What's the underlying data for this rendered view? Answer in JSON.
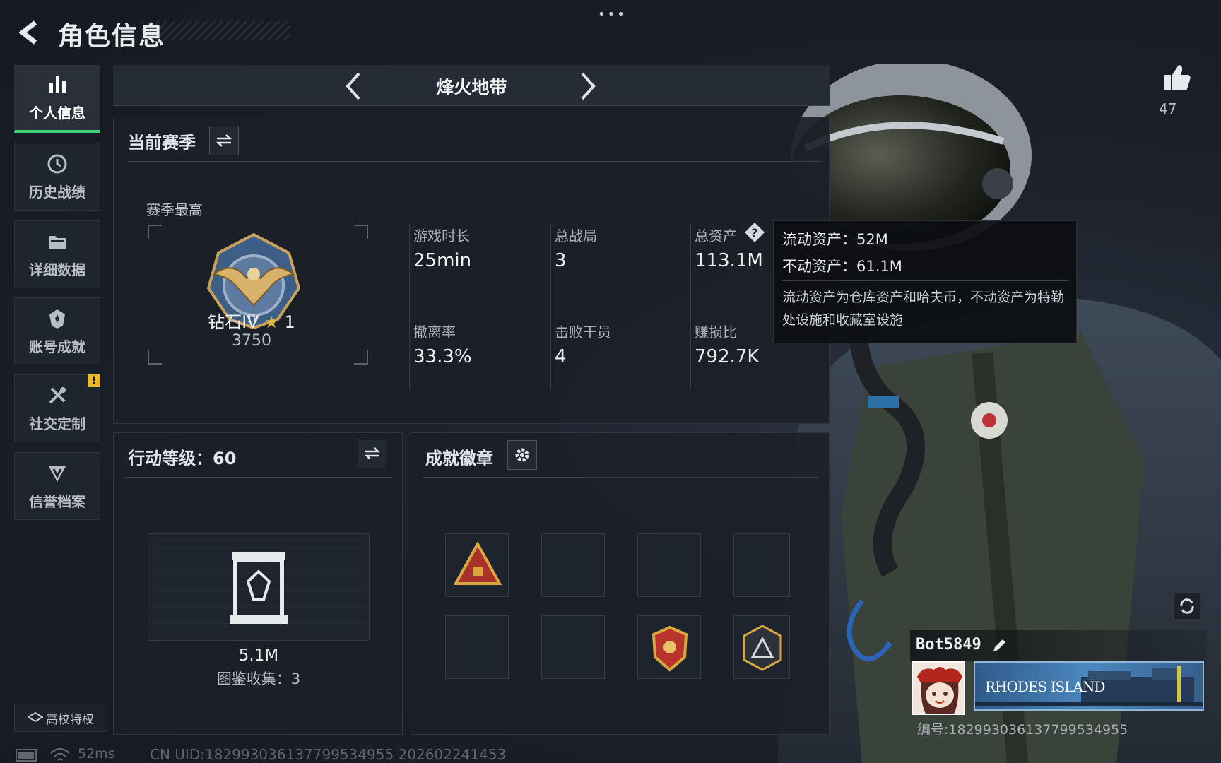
{
  "header": {
    "title": "角色信息",
    "more": "•••"
  },
  "sidebar": {
    "items": [
      {
        "label": "个人信息",
        "icon": "bar-chart-icon",
        "active": true
      },
      {
        "label": "历史战绩",
        "icon": "history-icon"
      },
      {
        "label": "详细数据",
        "icon": "folder-icon"
      },
      {
        "label": "账号成就",
        "icon": "achievement-icon"
      },
      {
        "label": "社交定制",
        "icon": "tools-icon",
        "alert": "!"
      },
      {
        "label": "信誉档案",
        "icon": "credit-icon"
      }
    ],
    "campus": "高校特权"
  },
  "mode": {
    "name": "烽火地带"
  },
  "season": {
    "title": "当前赛季",
    "best_label": "赛季最高",
    "rank": "钻石IV",
    "stars": "1",
    "rank_score": "3750",
    "stats": [
      {
        "label": "游戏时长",
        "value": "25min"
      },
      {
        "label": "总战局",
        "value": "3"
      },
      {
        "label": "总资产",
        "value": "113.1M"
      },
      {
        "label": "撤离率",
        "value": "33.3%"
      },
      {
        "label": "击败干员",
        "value": "4"
      },
      {
        "label": "赚损比",
        "value": "792.7K"
      }
    ]
  },
  "tooltip": {
    "liquid": "流动资产：52M",
    "fixed": "不动资产：61.1M",
    "desc": "流动资产为仓库资产和哈夫币，不动资产为特勤处设施和收藏室设施"
  },
  "action": {
    "title": "行动等级：60",
    "value": "5.1M",
    "collection": "图鉴收集：3"
  },
  "badges": {
    "title": "成就徽章"
  },
  "player": {
    "name": "Bot5849",
    "banner_text": "RHODES ISLAND",
    "uid": "编号:1829930361377995349​55",
    "likes": "47"
  },
  "footer": {
    "ping": "52ms",
    "uid": "CN UID:1829930361377995349​55 202602241453"
  },
  "colors": {
    "accent": "#3fd07a",
    "warning": "#e8b82c"
  }
}
